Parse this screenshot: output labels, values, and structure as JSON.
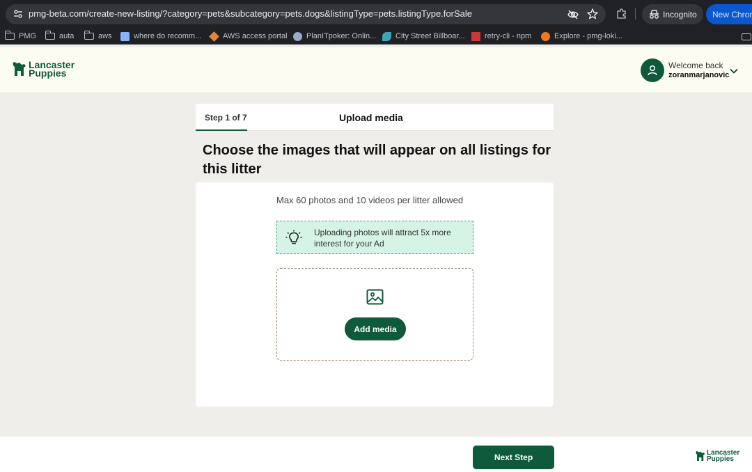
{
  "browser": {
    "url": "pmg-beta.com/create-new-listing/?category=pets&subcategory=pets.dogs&listingType=pets.listingType.forSale",
    "incognito_label": "Incognito",
    "new_chrome_label": "New Chrom",
    "bookmarks": [
      {
        "label": "PMG",
        "icon": "folder-icon"
      },
      {
        "label": "auta",
        "icon": "folder-icon"
      },
      {
        "label": "aws",
        "icon": "folder-icon"
      },
      {
        "label": "where do recomm...",
        "icon": "bookmark-favicon"
      },
      {
        "label": "AWS access portal",
        "icon": "aws-favicon"
      },
      {
        "label": "PlanITpoker: Onlin...",
        "icon": "planitpoker-favicon"
      },
      {
        "label": "City Street Billboar...",
        "icon": "billboard-favicon"
      },
      {
        "label": "retry-cli - npm",
        "icon": "npm-favicon"
      },
      {
        "label": "Explore - pmg-loki...",
        "icon": "grafana-favicon"
      }
    ]
  },
  "header": {
    "logo_line1": "Lancaster",
    "logo_line2": "Puppies",
    "welcome_label": "Welcome back",
    "username": "zoranmarjanovic"
  },
  "steps": {
    "step_label": "Step 1 of 7",
    "step_title": "Upload media"
  },
  "main": {
    "heading": "Choose the images that will appear on all listings for this litter",
    "max_info": "Max 60 photos and 10 videos per litter allowed",
    "tip_text": "Uploading photos will attract 5x more interest for your Ad",
    "add_media_label": "Add media"
  },
  "footer": {
    "next_label": "Next Step",
    "logo_line1": "Lancaster",
    "logo_line2": "Puppies"
  },
  "colors": {
    "brand_green": "#0e5a3a",
    "tip_background": "#d6f4e5",
    "page_background": "#efeeeb"
  }
}
